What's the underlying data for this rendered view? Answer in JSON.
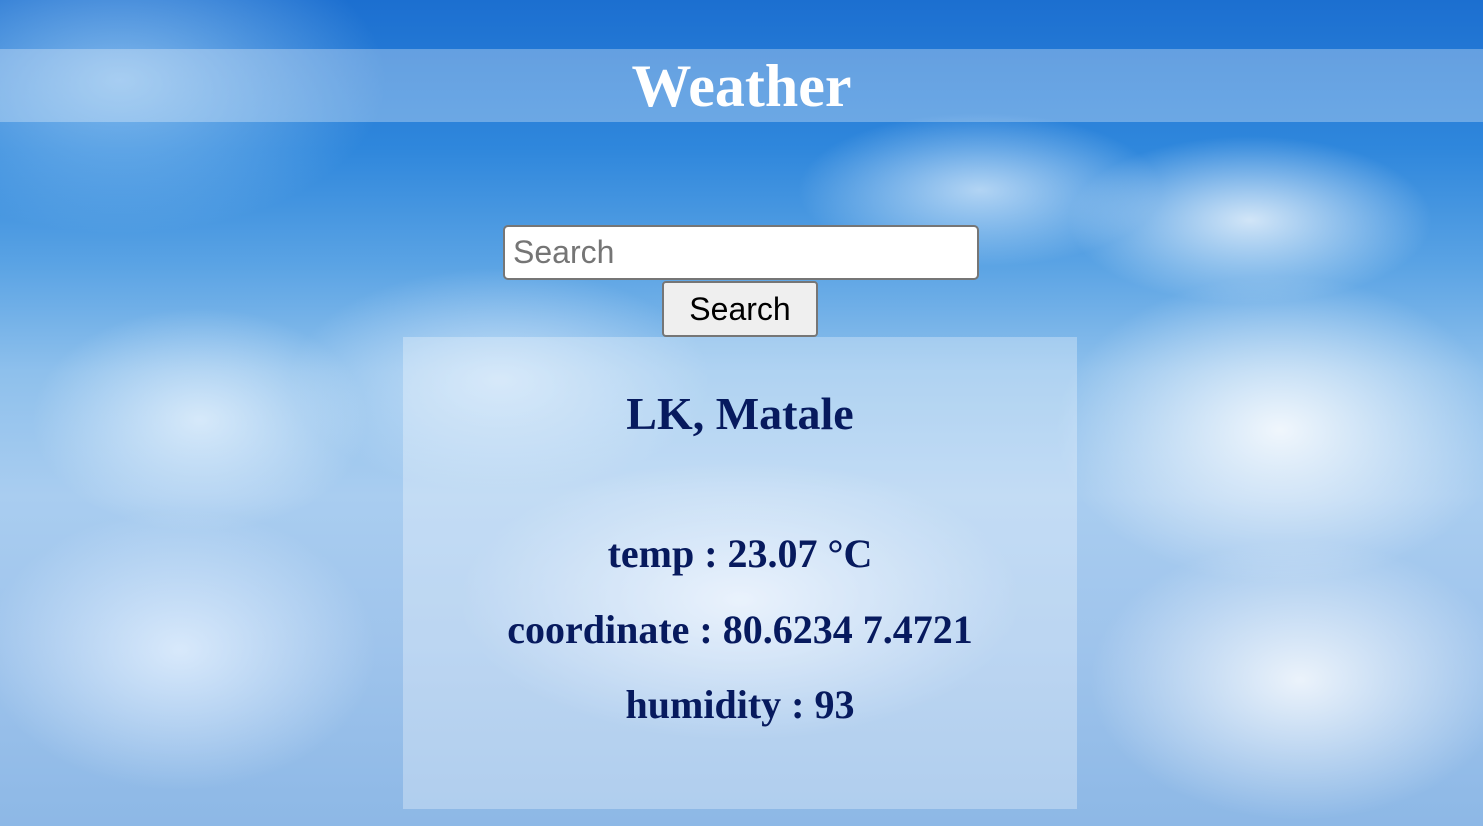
{
  "app": {
    "title": "Weather"
  },
  "search": {
    "placeholder": "Search",
    "value": "",
    "button_label": "Search"
  },
  "result": {
    "location": "LK, Matale",
    "temp": "temp : 23.07 °C",
    "coordinate": "coordinate : 80.6234 7.4721",
    "humidity": "humidity : 93"
  },
  "colors": {
    "title_text": "#ffffff",
    "result_text": "#071a5e",
    "sky": "#5aa3e4"
  }
}
